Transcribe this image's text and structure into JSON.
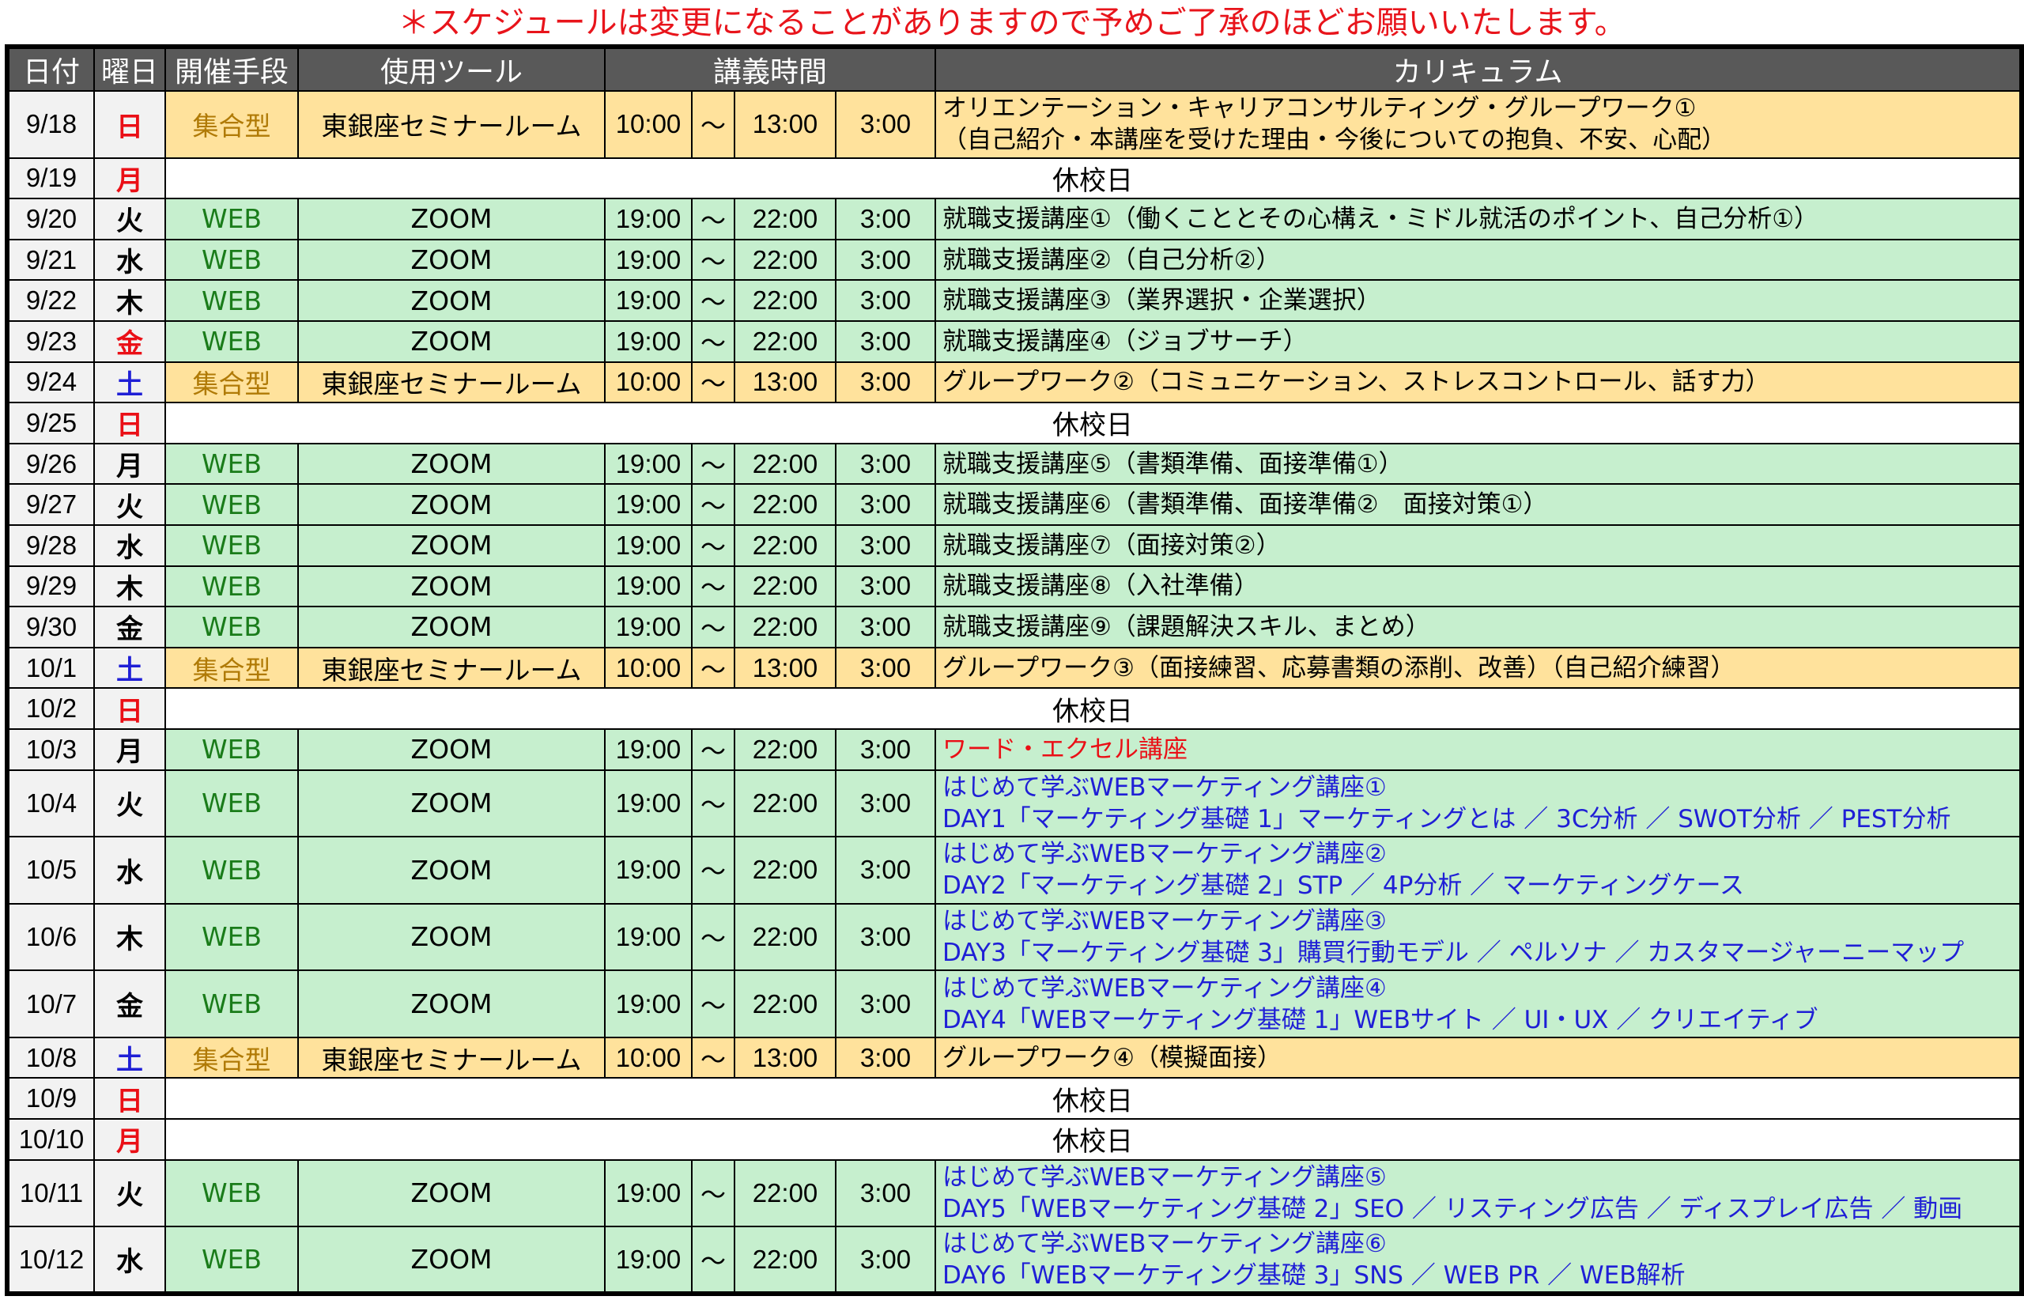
{
  "notice": "＊スケジュールは変更になることがありますので予めご了承のほどお願いいたします。",
  "headers": {
    "date": "日付",
    "day": "曜日",
    "method": "開催手段",
    "tool": "使用ツール",
    "time": "講義時間",
    "curriculum": "カリキュラム"
  },
  "colors": {
    "notice_red": "#e8141b",
    "header_gray": "#595959",
    "web_green": "#c6efce",
    "group_yellow": "#ffe29c",
    "sat_blue": "#1f1fd6"
  },
  "rows": [
    {
      "date": "9/18",
      "day": "日",
      "day_color": "sun",
      "type": "group",
      "method": "集合型",
      "tool": "東銀座セミナールーム",
      "start": "10:00",
      "sep": "～",
      "end": "13:00",
      "dur": "3:00",
      "cur": [
        "オリエンテーション・キャリアコンサルティング・グループワーク①",
        "（自己紹介・本講座を受けた理由・今後についての抱負、不安、心配）"
      ],
      "cur_color": "black"
    },
    {
      "date": "9/19",
      "day": "月",
      "day_color": "mon-red",
      "type": "closed",
      "closed_label": "休校日"
    },
    {
      "date": "9/20",
      "day": "火",
      "day_color": "plain",
      "type": "web",
      "method": "WEB",
      "tool": "ZOOM",
      "start": "19:00",
      "sep": "～",
      "end": "22:00",
      "dur": "3:00",
      "cur": [
        "就職支援講座①（働くこととその心構え・ミドル就活のポイント、自己分析①）"
      ],
      "cur_color": "black"
    },
    {
      "date": "9/21",
      "day": "水",
      "day_color": "plain",
      "type": "web",
      "method": "WEB",
      "tool": "ZOOM",
      "start": "19:00",
      "sep": "～",
      "end": "22:00",
      "dur": "3:00",
      "cur": [
        "就職支援講座②（自己分析②）"
      ],
      "cur_color": "black"
    },
    {
      "date": "9/22",
      "day": "木",
      "day_color": "plain",
      "type": "web",
      "method": "WEB",
      "tool": "ZOOM",
      "start": "19:00",
      "sep": "～",
      "end": "22:00",
      "dur": "3:00",
      "cur": [
        "就職支援講座③（業界選択・企業選択）"
      ],
      "cur_color": "black"
    },
    {
      "date": "9/23",
      "day": "金",
      "day_color": "fri",
      "type": "web",
      "method": "WEB",
      "tool": "ZOOM",
      "start": "19:00",
      "sep": "～",
      "end": "22:00",
      "dur": "3:00",
      "cur": [
        "就職支援講座④（ジョブサーチ）"
      ],
      "cur_color": "black"
    },
    {
      "date": "9/24",
      "day": "土",
      "day_color": "sat",
      "type": "group",
      "method": "集合型",
      "tool": "東銀座セミナールーム",
      "start": "10:00",
      "sep": "～",
      "end": "13:00",
      "dur": "3:00",
      "cur": [
        "グループワーク②（コミュニケーション、ストレスコントロール、話す力）"
      ],
      "cur_color": "black"
    },
    {
      "date": "9/25",
      "day": "日",
      "day_color": "sun",
      "type": "closed",
      "closed_label": "休校日"
    },
    {
      "date": "9/26",
      "day": "月",
      "day_color": "plain",
      "type": "web",
      "method": "WEB",
      "tool": "ZOOM",
      "start": "19:00",
      "sep": "～",
      "end": "22:00",
      "dur": "3:00",
      "cur": [
        "就職支援講座⑤（書類準備、面接準備①）"
      ],
      "cur_color": "black"
    },
    {
      "date": "9/27",
      "day": "火",
      "day_color": "plain",
      "type": "web",
      "method": "WEB",
      "tool": "ZOOM",
      "start": "19:00",
      "sep": "～",
      "end": "22:00",
      "dur": "3:00",
      "cur": [
        "就職支援講座⑥（書類準備、面接準備②　面接対策①）"
      ],
      "cur_color": "black"
    },
    {
      "date": "9/28",
      "day": "水",
      "day_color": "plain",
      "type": "web",
      "method": "WEB",
      "tool": "ZOOM",
      "start": "19:00",
      "sep": "～",
      "end": "22:00",
      "dur": "3:00",
      "cur": [
        "就職支援講座⑦（面接対策②）"
      ],
      "cur_color": "black"
    },
    {
      "date": "9/29",
      "day": "木",
      "day_color": "plain",
      "type": "web",
      "method": "WEB",
      "tool": "ZOOM",
      "start": "19:00",
      "sep": "～",
      "end": "22:00",
      "dur": "3:00",
      "cur": [
        "就職支援講座⑧（入社準備）"
      ],
      "cur_color": "black"
    },
    {
      "date": "9/30",
      "day": "金",
      "day_color": "plain",
      "type": "web",
      "method": "WEB",
      "tool": "ZOOM",
      "start": "19:00",
      "sep": "～",
      "end": "22:00",
      "dur": "3:00",
      "cur": [
        "就職支援講座⑨（課題解決スキル、まとめ）"
      ],
      "cur_color": "black"
    },
    {
      "date": "10/1",
      "day": "土",
      "day_color": "sat",
      "type": "group",
      "method": "集合型",
      "tool": "東銀座セミナールーム",
      "start": "10:00",
      "sep": "～",
      "end": "13:00",
      "dur": "3:00",
      "cur": [
        "グループワーク③（面接練習、応募書類の添削、改善）（自己紹介練習）"
      ],
      "cur_color": "black"
    },
    {
      "date": "10/2",
      "day": "日",
      "day_color": "sun",
      "type": "closed",
      "closed_label": "休校日"
    },
    {
      "date": "10/3",
      "day": "月",
      "day_color": "plain",
      "type": "web",
      "method": "WEB",
      "tool": "ZOOM",
      "start": "19:00",
      "sep": "～",
      "end": "22:00",
      "dur": "3:00",
      "cur": [
        "ワード・エクセル講座"
      ],
      "cur_color": "red"
    },
    {
      "date": "10/4",
      "day": "火",
      "day_color": "plain",
      "type": "web",
      "method": "WEB",
      "tool": "ZOOM",
      "start": "19:00",
      "sep": "～",
      "end": "22:00",
      "dur": "3:00",
      "cur": [
        "はじめて学ぶWEBマーケティング講座①",
        "DAY1「マーケティング基礎 1」マーケティングとは ／ 3C分析 ／ SWOT分析 ／ PEST分析"
      ],
      "cur_color": "blue"
    },
    {
      "date": "10/5",
      "day": "水",
      "day_color": "plain",
      "type": "web",
      "method": "WEB",
      "tool": "ZOOM",
      "start": "19:00",
      "sep": "～",
      "end": "22:00",
      "dur": "3:00",
      "cur": [
        "はじめて学ぶWEBマーケティング講座②",
        "DAY2「マーケティング基礎 2」STP ／ 4P分析 ／ マーケティングケース"
      ],
      "cur_color": "blue"
    },
    {
      "date": "10/6",
      "day": "木",
      "day_color": "plain",
      "type": "web",
      "method": "WEB",
      "tool": "ZOOM",
      "start": "19:00",
      "sep": "～",
      "end": "22:00",
      "dur": "3:00",
      "cur": [
        "はじめて学ぶWEBマーケティング講座③",
        "DAY3「マーケティング基礎 3」購買行動モデル ／ ペルソナ ／ カスタマージャーニーマップ"
      ],
      "cur_color": "blue"
    },
    {
      "date": "10/7",
      "day": "金",
      "day_color": "plain",
      "type": "web",
      "method": "WEB",
      "tool": "ZOOM",
      "start": "19:00",
      "sep": "～",
      "end": "22:00",
      "dur": "3:00",
      "cur": [
        "はじめて学ぶWEBマーケティング講座④",
        "DAY4「WEBマーケティング基礎 1」WEBサイト ／ UI・UX ／ クリエイティブ"
      ],
      "cur_color": "blue"
    },
    {
      "date": "10/8",
      "day": "土",
      "day_color": "sat",
      "type": "group",
      "method": "集合型",
      "tool": "東銀座セミナールーム",
      "start": "10:00",
      "sep": "～",
      "end": "13:00",
      "dur": "3:00",
      "cur": [
        "グループワーク④（模擬面接）"
      ],
      "cur_color": "black"
    },
    {
      "date": "10/9",
      "day": "日",
      "day_color": "sun",
      "type": "closed",
      "closed_label": "休校日"
    },
    {
      "date": "10/10",
      "day": "月",
      "day_color": "mon-red",
      "type": "closed",
      "closed_label": "休校日"
    },
    {
      "date": "10/11",
      "day": "火",
      "day_color": "plain",
      "type": "web",
      "method": "WEB",
      "tool": "ZOOM",
      "start": "19:00",
      "sep": "～",
      "end": "22:00",
      "dur": "3:00",
      "cur": [
        "はじめて学ぶWEBマーケティング講座⑤",
        "DAY5「WEBマーケティング基礎 2」SEO ／ リスティング広告 ／ ディスプレイ広告 ／ 動画"
      ],
      "cur_color": "blue"
    },
    {
      "date": "10/12",
      "day": "水",
      "day_color": "plain",
      "type": "web",
      "method": "WEB",
      "tool": "ZOOM",
      "start": "19:00",
      "sep": "～",
      "end": "22:00",
      "dur": "3:00",
      "cur": [
        "はじめて学ぶWEBマーケティング講座⑥",
        "DAY6「WEBマーケティング基礎 3」SNS ／ WEB PR ／ WEB解析"
      ],
      "cur_color": "blue"
    }
  ]
}
